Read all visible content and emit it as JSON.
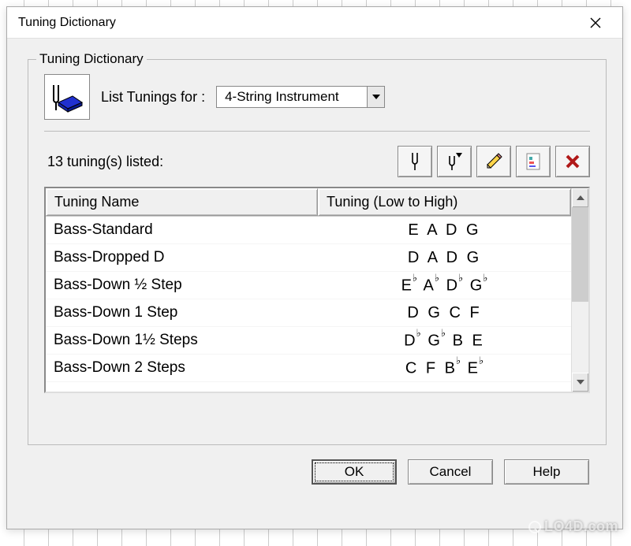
{
  "window": {
    "title": "Tuning Dictionary"
  },
  "fieldset": {
    "legend": "Tuning Dictionary",
    "list_label": "List Tunings for :",
    "instrument_selected": "4-String Instrument",
    "count_text": "13 tuning(s) listed:"
  },
  "table": {
    "col_name": "Tuning Name",
    "col_tuning": "Tuning (Low to High)",
    "rows": [
      {
        "name": "Bass-Standard",
        "tuning": "E A D G",
        "flats": false
      },
      {
        "name": "Bass-Dropped D",
        "tuning": "D A D G",
        "flats": false
      },
      {
        "name": "Bass-Down ½ Step",
        "tuning": "E♭A♭D♭G♭",
        "flats": true,
        "notes": [
          "E",
          "A",
          "D",
          "G"
        ]
      },
      {
        "name": "Bass-Down 1 Step",
        "tuning": "D G C F",
        "flats": false
      },
      {
        "name": "Bass-Down 1½ Steps",
        "tuning": "D♭G♭B E",
        "flats": true,
        "notes": [
          "D",
          "G",
          "B",
          "E"
        ],
        "flatMask": [
          true,
          true,
          false,
          false
        ]
      },
      {
        "name": "Bass-Down 2 Steps",
        "tuning": "C F B♭E♭",
        "flats": true,
        "notes": [
          "C",
          "F",
          "B",
          "E"
        ],
        "flatMask": [
          false,
          false,
          true,
          true
        ]
      }
    ]
  },
  "buttons": {
    "ok": "OK",
    "cancel": "Cancel",
    "help": "Help"
  },
  "toolbar": {
    "btn1": "tuning-fork-icon",
    "btn2": "tuning-fork-filter-icon",
    "btn3": "pencil-icon",
    "btn4": "page-icon",
    "btn5": "delete-icon"
  },
  "watermark": "LO4D.com"
}
